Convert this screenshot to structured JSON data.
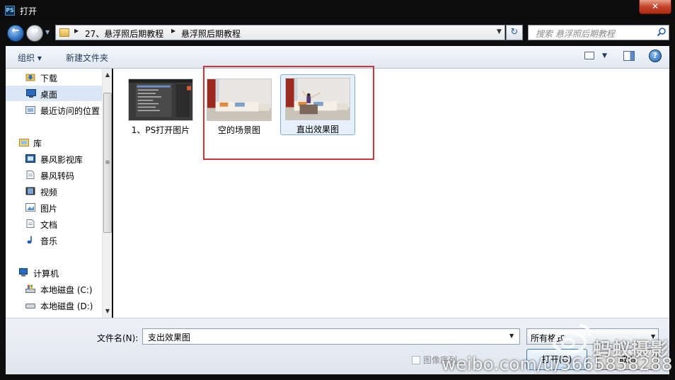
{
  "window": {
    "title": "打开",
    "app_icon": "PS",
    "close_label": "✕"
  },
  "address": {
    "breadcrumbs": [
      "27、悬浮照后期教程",
      "悬浮照后期教程"
    ],
    "search_placeholder": "搜索 悬浮照后期教程"
  },
  "toolbar": {
    "organize_label": "组织 ▾",
    "new_folder_label": "新建文件夹",
    "help_label": "?"
  },
  "sidebar": {
    "favorites": [
      {
        "label": "下载",
        "icon": "download-folder-icon"
      },
      {
        "label": "桌面",
        "icon": "desktop-icon",
        "selected": true
      },
      {
        "label": "最近访问的位置",
        "icon": "recent-places-icon"
      }
    ],
    "libraries_label": "库",
    "libraries": [
      {
        "label": "暴风影视库",
        "icon": "video-library-icon"
      },
      {
        "label": "暴风转码",
        "icon": "document-icon"
      },
      {
        "label": "视频",
        "icon": "film-icon"
      },
      {
        "label": "图片",
        "icon": "picture-icon"
      },
      {
        "label": "文档",
        "icon": "document-icon"
      },
      {
        "label": "音乐",
        "icon": "music-note-icon"
      }
    ],
    "computer_label": "计算机",
    "drives": [
      {
        "label": "本地磁盘 (C:)",
        "icon": "windows-drive-icon"
      },
      {
        "label": "本地磁盘 (D:)",
        "icon": "drive-icon"
      }
    ]
  },
  "files": [
    {
      "name": "1、PS打开图片",
      "thumb": "screenshot-thumbnail",
      "selected": false
    },
    {
      "name": "空的场景图",
      "thumb": "empty-room-thumbnail",
      "selected": false
    },
    {
      "name": "直出效果图",
      "thumb": "levitation-thumbnail",
      "selected": true
    }
  ],
  "footer": {
    "filename_label": "文件名(N):",
    "filename_value": "支出效果图",
    "filetype_value": "所有格式",
    "sequence_label": "图像序列",
    "open_label": "打开(O)",
    "cancel_label": "取消"
  },
  "watermark": {
    "brand": "蚂蚁摄影",
    "url": "weibo.com/u/3665858288"
  },
  "colors": {
    "highlight_border": "#d0333a",
    "selection_bg": "#dbe7f6",
    "title_bar": "#0c0c0c"
  }
}
